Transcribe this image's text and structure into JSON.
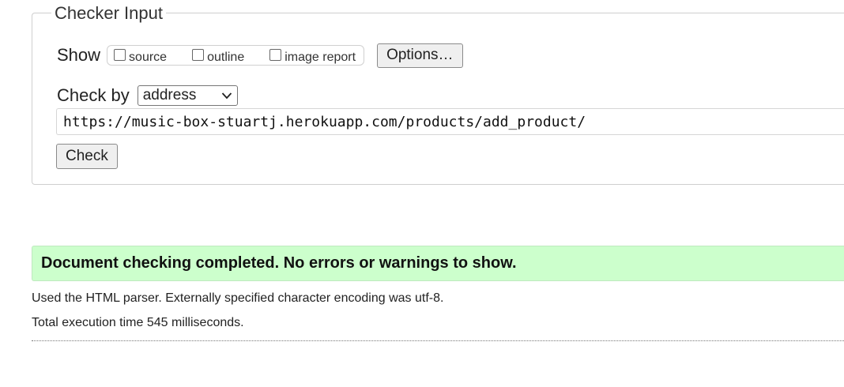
{
  "checker": {
    "legend": "Checker Input",
    "show_label": "Show",
    "options": [
      {
        "label": "source",
        "checked": false
      },
      {
        "label": "outline",
        "checked": false
      },
      {
        "label": "image report",
        "checked": false
      }
    ],
    "options_button": "Options…",
    "check_by_label": "Check by",
    "check_by_value": "address",
    "url_value": "https://music-box-stuartj.herokuapp.com/products/add_product/",
    "check_button": "Check"
  },
  "results": {
    "success_message": "Document checking completed. No errors or warnings to show.",
    "success_color": "#ccffcc",
    "parser_info": "Used the HTML parser. Externally specified character encoding was utf-8.",
    "execution_time": "Total execution time 545 milliseconds."
  }
}
